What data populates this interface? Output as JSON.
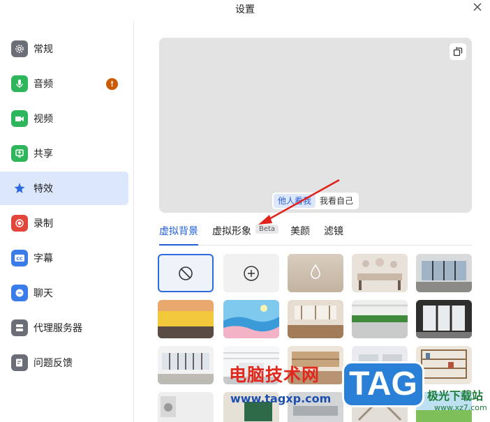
{
  "window": {
    "title": "设置",
    "close_icon": "close-icon"
  },
  "sidebar": {
    "items": [
      {
        "label": "常规",
        "icon": "gear-icon",
        "icon_color": "#6b6e76"
      },
      {
        "label": "音频",
        "icon": "microphone-icon",
        "icon_color": "#2fb55b",
        "badge": "!"
      },
      {
        "label": "视频",
        "icon": "video-camera-icon",
        "icon_color": "#2fb55b"
      },
      {
        "label": "共享",
        "icon": "share-screen-icon",
        "icon_color": "#2fb55b"
      },
      {
        "label": "特效",
        "icon": "effects-star-icon",
        "icon_color": "#2d6ae0"
      },
      {
        "label": "录制",
        "icon": "record-icon",
        "icon_color": "#e2473b"
      },
      {
        "label": "字幕",
        "icon": "cc-icon",
        "icon_color": "#3a7de8"
      },
      {
        "label": "聊天",
        "icon": "chat-bubble-icon",
        "icon_color": "#3a7de8"
      },
      {
        "label": "代理服务器",
        "icon": "server-icon",
        "icon_color": "#6b6e76"
      },
      {
        "label": "问题反馈",
        "icon": "feedback-icon",
        "icon_color": "#6b6e76"
      }
    ],
    "active_index": 4
  },
  "preview": {
    "flip_icon": "mirror-flip-icon",
    "toggle": {
      "options": [
        "他人看我",
        "我看自己"
      ],
      "selected": "他人看我"
    }
  },
  "tabs": {
    "items": [
      "虚拟背景",
      "虚拟形象",
      "美颜",
      "滤镜"
    ],
    "active": "虚拟背景",
    "beta_label": "Beta"
  },
  "backgrounds": {
    "controls": [
      "none-icon",
      "add-icon",
      "blur-icon"
    ],
    "thumbnails": [
      "wall-art-room",
      "window-office",
      "yellow-wall",
      "illustrated-seaside",
      "cafe-interior",
      "plant-office",
      "dark-window-room",
      "bright-office",
      "white-hall",
      "library-room",
      "modern-lobby",
      "bookshelf-room",
      "laundry-room",
      "green-chalkboard-room",
      "gray-room",
      "lobby-stairs",
      "green-field"
    ]
  },
  "watermark": {
    "cn_text": "电脑技术网",
    "url": "www.tagxp.com",
    "tag": "TAG",
    "site": "极光下载站",
    "site_url": "www.xz7.com"
  }
}
